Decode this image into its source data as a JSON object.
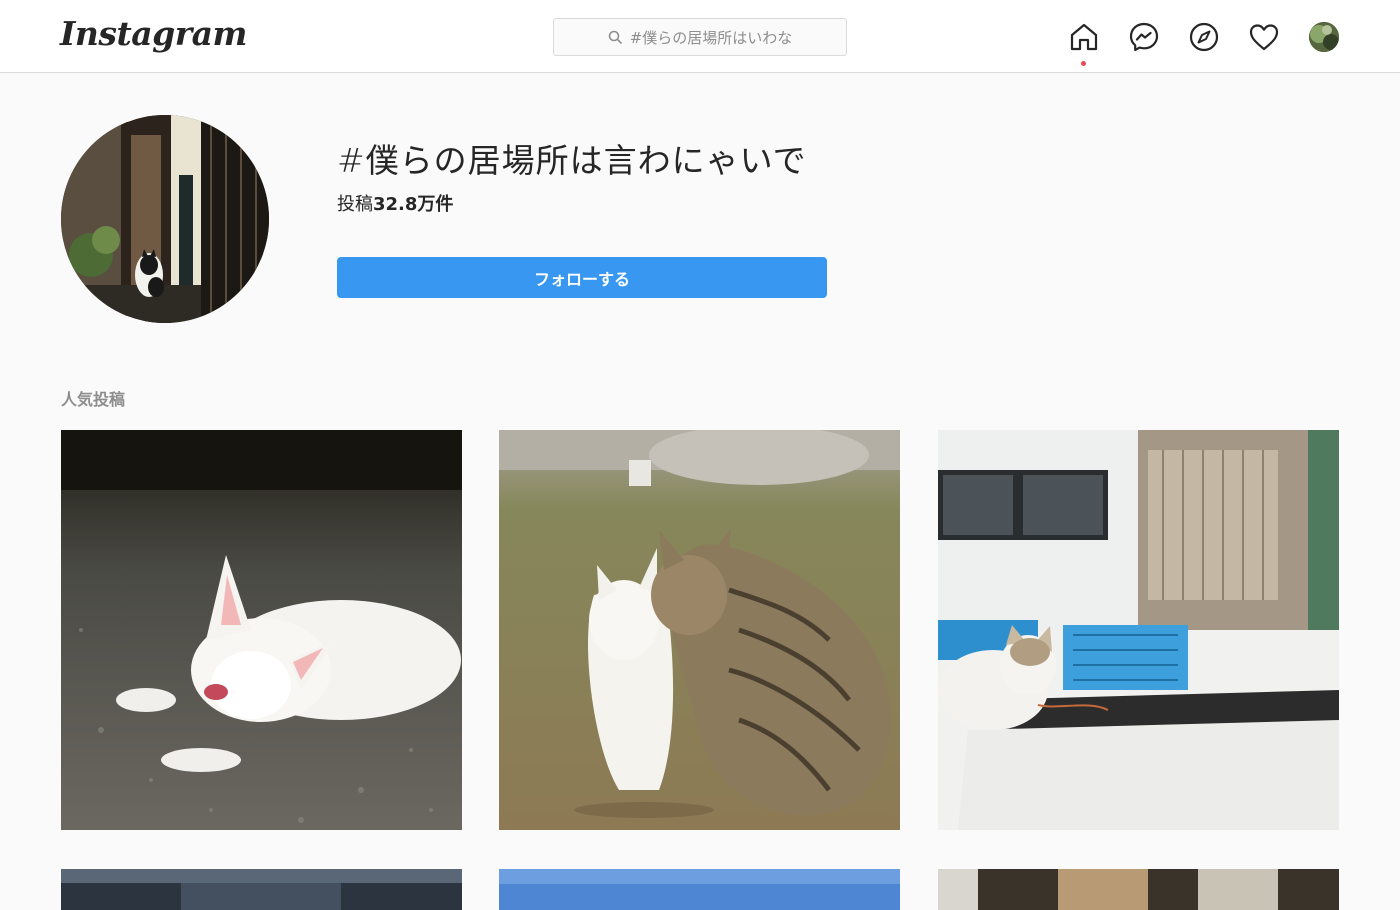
{
  "nav": {
    "logo": "Instagram",
    "search_placeholder": "#僕らの居場所はいわな"
  },
  "icons": [
    "home-icon",
    "messenger-icon",
    "explore-compass-icon",
    "activity-heart-icon"
  ],
  "colors": {
    "accent": "#3897f0",
    "notification_dot": "#ed4956"
  },
  "hashtag": {
    "title": "#僕らの居場所は言わにゃいで",
    "posts_label": "投稿",
    "posts_count": "32.8万件",
    "follow_label": "フォローする"
  },
  "section": {
    "top_posts_label": "人気投稿"
  }
}
